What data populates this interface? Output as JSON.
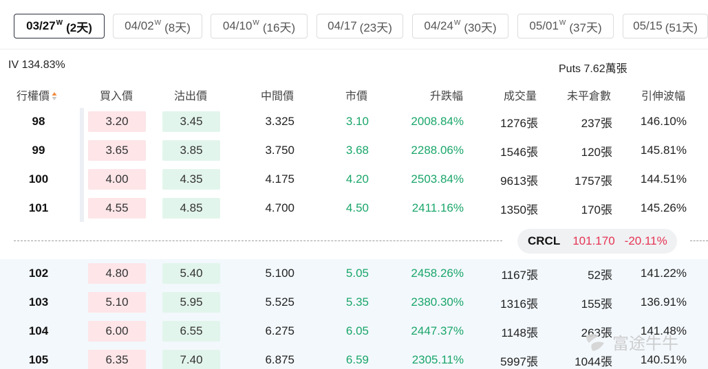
{
  "expiry_tabs": [
    {
      "date": "03/27",
      "weekly": "W",
      "days": "(2天)",
      "active": true
    },
    {
      "date": "04/02",
      "weekly": "W",
      "days": "(8天)",
      "active": false
    },
    {
      "date": "04/10",
      "weekly": "W",
      "days": "(16天)",
      "active": false
    },
    {
      "date": "04/17",
      "weekly": "",
      "days": "(23天)",
      "active": false
    },
    {
      "date": "04/24",
      "weekly": "W",
      "days": "(30天)",
      "active": false
    },
    {
      "date": "05/01",
      "weekly": "W",
      "days": "(37天)",
      "active": false
    },
    {
      "date": "05/15",
      "weekly": "",
      "days": "(51天)",
      "active": false
    }
  ],
  "summary": {
    "iv": "IV 134.83%",
    "puts": "Puts 7.62萬張"
  },
  "headers": {
    "strike": "行權價",
    "bid": "買入價",
    "ask": "沽出價",
    "mid": "中間價",
    "last": "市價",
    "change": "升跌幅",
    "volume": "成交量",
    "open_interest": "未平倉數",
    "implied_vol": "引伸波幅"
  },
  "rows_above": [
    {
      "strike": "98",
      "bid": "3.20",
      "ask": "3.45",
      "mid": "3.325",
      "last": "3.10",
      "change": "2008.84%",
      "volume": "1276張",
      "oi": "237張",
      "iv": "146.10%"
    },
    {
      "strike": "99",
      "bid": "3.65",
      "ask": "3.85",
      "mid": "3.750",
      "last": "3.68",
      "change": "2288.06%",
      "volume": "1546張",
      "oi": "120張",
      "iv": "145.81%"
    },
    {
      "strike": "100",
      "bid": "4.00",
      "ask": "4.35",
      "mid": "4.175",
      "last": "4.20",
      "change": "2503.84%",
      "volume": "9613張",
      "oi": "1757張",
      "iv": "144.51%"
    },
    {
      "strike": "101",
      "bid": "4.55",
      "ask": "4.85",
      "mid": "4.700",
      "last": "4.50",
      "change": "2411.16%",
      "volume": "1350張",
      "oi": "170張",
      "iv": "145.26%"
    }
  ],
  "underlying": {
    "symbol": "CRCL",
    "price": "101.170",
    "change": "-20.11%"
  },
  "rows_below": [
    {
      "strike": "102",
      "bid": "4.80",
      "ask": "5.40",
      "mid": "5.100",
      "last": "5.05",
      "change": "2458.26%",
      "volume": "1167張",
      "oi": "52張",
      "iv": "141.22%"
    },
    {
      "strike": "103",
      "bid": "5.10",
      "ask": "5.95",
      "mid": "5.525",
      "last": "5.35",
      "change": "2380.30%",
      "volume": "1316張",
      "oi": "155張",
      "iv": "136.91%"
    },
    {
      "strike": "104",
      "bid": "6.00",
      "ask": "6.55",
      "mid": "6.275",
      "last": "6.05",
      "change": "2447.37%",
      "volume": "1148張",
      "oi": "263張",
      "iv": "141.48%"
    },
    {
      "strike": "105",
      "bid": "6.35",
      "ask": "7.40",
      "mid": "6.875",
      "last": "6.59",
      "change": "2305.11%",
      "volume": "5997張",
      "oi": "1044張",
      "iv": "140.51%"
    }
  ],
  "watermark": "富途牛牛",
  "colors": {
    "up": "#1aa66a",
    "down": "#e53453",
    "bid_bg": "#fde5e8",
    "ask_bg": "#e2f5ec"
  }
}
